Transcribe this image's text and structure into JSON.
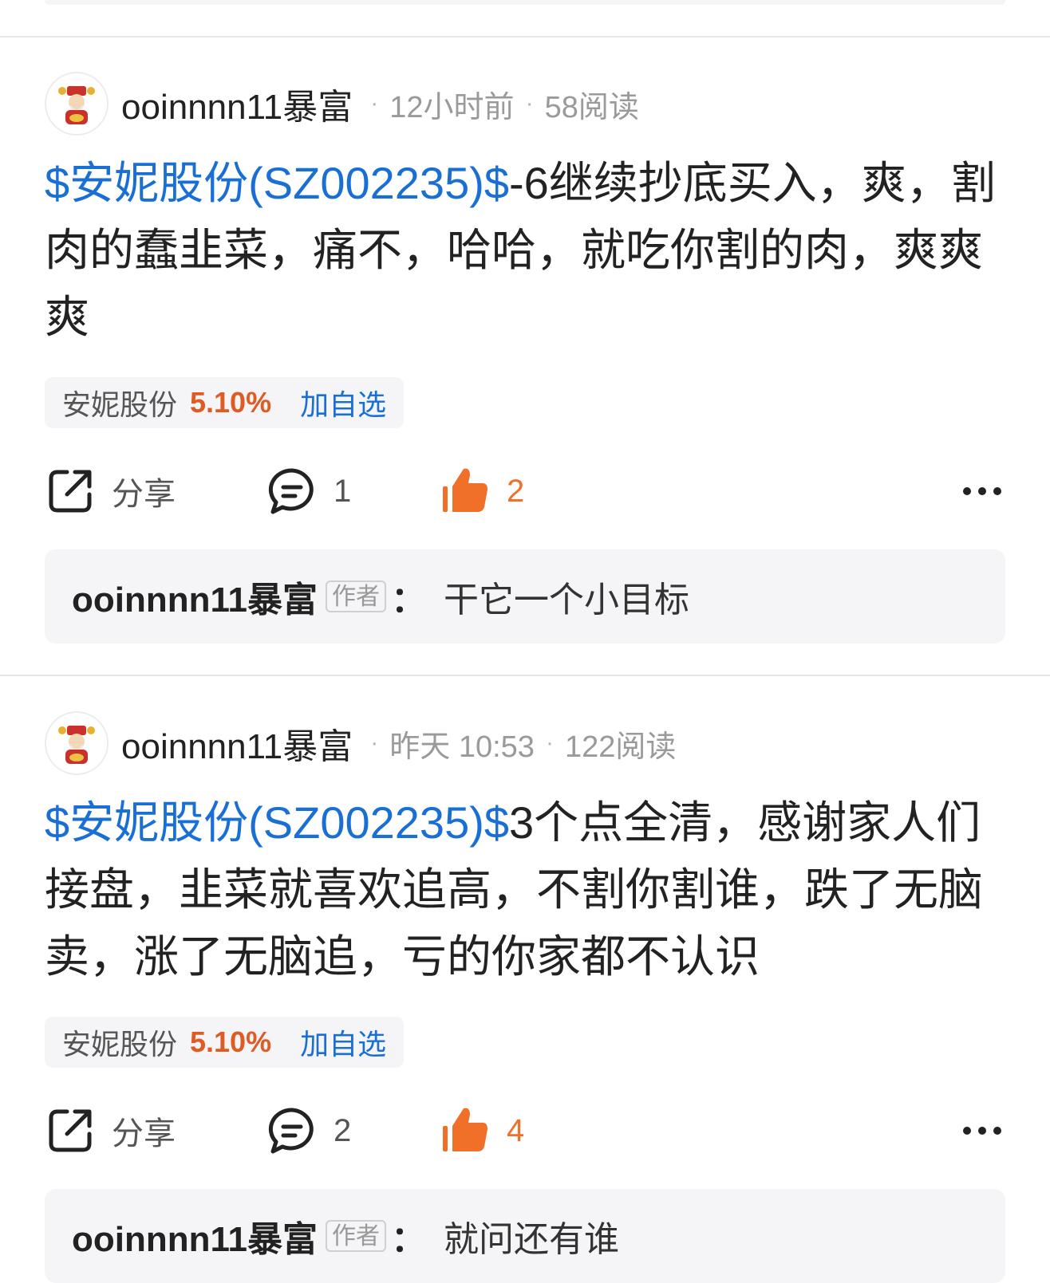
{
  "posts": [
    {
      "author": "ooinnnn11暴富",
      "time": "12小时前",
      "reads": "58阅读",
      "stock_link": "$安妮股份(SZ002235)$",
      "content": "-6继续抄底买入，爽，割肉的蠢韭菜，痛不，哈哈，就吃你割的肉，爽爽爽",
      "stock_tag": {
        "name": "安妮股份",
        "change": "5.10%",
        "add": "加自选"
      },
      "share_label": "分享",
      "comment_count": "1",
      "like_count": "2",
      "top_comment": {
        "author": "ooinnnn11暴富",
        "badge": "作者",
        "colon": "：",
        "text": "干它一个小目标"
      }
    },
    {
      "author": "ooinnnn11暴富",
      "time": "昨天 10:53",
      "reads": "122阅读",
      "stock_link": "$安妮股份(SZ002235)$",
      "content": "3个点全清，感谢家人们接盘，韭菜就喜欢追高，不割你割谁，跌了无脑卖，涨了无脑追，亏的你家都不认识",
      "stock_tag": {
        "name": "安妮股份",
        "change": "5.10%",
        "add": "加自选"
      },
      "share_label": "分享",
      "comment_count": "2",
      "like_count": "4",
      "top_comment": {
        "author": "ooinnnn11暴富",
        "badge": "作者",
        "colon": "：",
        "text": "就问还有谁"
      }
    }
  ],
  "colors": {
    "link_blue": "#1a6fd4",
    "rise_orange": "#e05a24",
    "like_orange": "#f0702a",
    "card_gray": "#f5f5f7"
  },
  "icons": [
    "avatar-caishen-icon",
    "share-icon",
    "comment-icon",
    "thumbs-up-icon",
    "more-icon"
  ]
}
